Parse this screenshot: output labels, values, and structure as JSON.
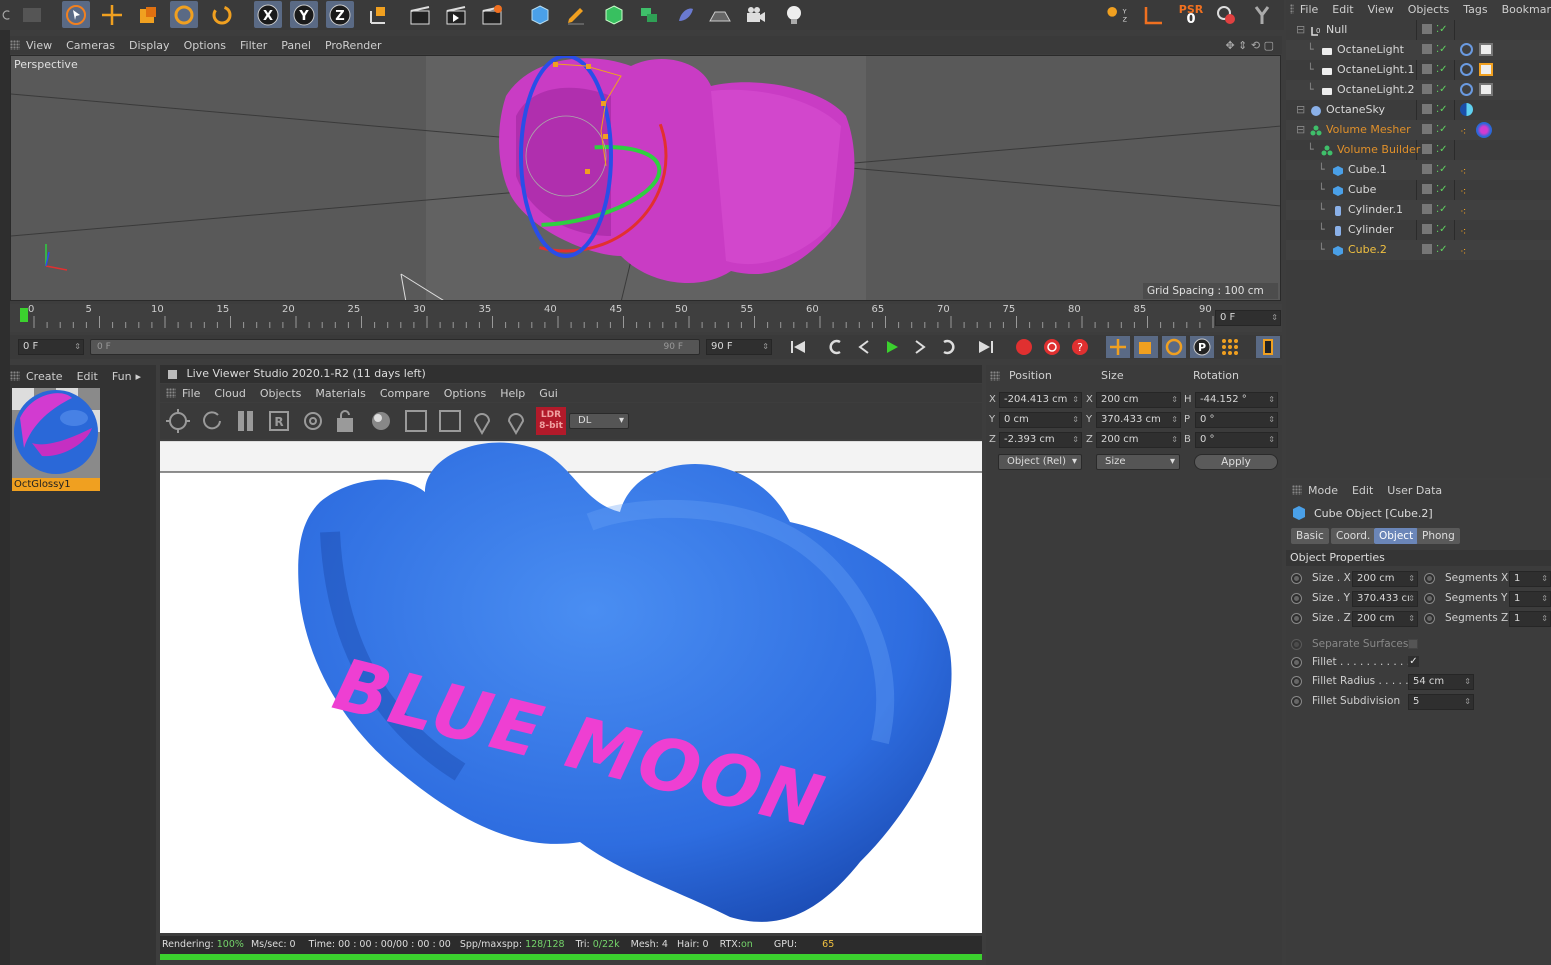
{
  "viewport": {
    "menu": [
      "View",
      "Cameras",
      "Display",
      "Options",
      "Filter",
      "Panel",
      "ProRender"
    ],
    "label": "Perspective",
    "grid_spacing": "Grid Spacing : 100 cm"
  },
  "timeline": {
    "ticks": [
      "0",
      "5",
      "10",
      "15",
      "20",
      "25",
      "30",
      "35",
      "40",
      "45",
      "50",
      "55",
      "60",
      "65",
      "70",
      "75",
      "80",
      "85",
      "90"
    ],
    "current_frame": "0 F",
    "start_field": "0 F",
    "range_start": "0 F",
    "range_end": "90 F",
    "end_field": "90 F"
  },
  "materials": {
    "menu": [
      "Create",
      "Edit",
      "Fun"
    ],
    "item_name": "OctGlossy1"
  },
  "live_viewer": {
    "title": "Live Viewer Studio 2020.1-R2 (11 days left)",
    "menu": [
      "File",
      "Cloud",
      "Objects",
      "Materials",
      "Compare",
      "Options",
      "Help",
      "Gui"
    ],
    "ldr_badge_1": "LDR",
    "ldr_badge_2": "8-bit",
    "mode_select": "DL",
    "render_text": "BLUE MOON",
    "status": {
      "rendering_label": "Rendering:",
      "rendering_value": "100%",
      "mssec": "Ms/sec: 0",
      "time": "Time: 00 : 00 : 00/00 : 00 : 00",
      "spp_label": "Spp/maxspp:",
      "spp_value": "128/128",
      "tri_label": "Tri:",
      "tri_value": "0/22k",
      "mesh": "Mesh: 4",
      "hair": "Hair: 0",
      "rtx_label": "RTX:",
      "rtx_value": "on",
      "gpu_label": "GPU:",
      "gpu_value": "65"
    }
  },
  "coordinates": {
    "headers": [
      "Position",
      "Size",
      "Rotation"
    ],
    "rows": [
      {
        "pos_axis": "X",
        "pos": "-204.413 cm",
        "size_axis": "X",
        "size": "200 cm",
        "rot_axis": "H",
        "rot": "-44.152 °"
      },
      {
        "pos_axis": "Y",
        "pos": "0 cm",
        "size_axis": "Y",
        "size": "370.433 cm",
        "rot_axis": "P",
        "rot": "0 °"
      },
      {
        "pos_axis": "Z",
        "pos": "-2.393 cm",
        "size_axis": "Z",
        "size": "200 cm",
        "rot_axis": "B",
        "rot": "0 °"
      }
    ],
    "mode_select": "Object (Rel)",
    "size_select": "Size",
    "apply_label": "Apply"
  },
  "object_manager": {
    "menu": [
      "File",
      "Edit",
      "View",
      "Objects",
      "Tags",
      "Bookmar"
    ],
    "objects": [
      {
        "name": "Null",
        "color": "#d8d8d8"
      },
      {
        "name": "OctaneLight",
        "color": "#d8d8d8"
      },
      {
        "name": "OctaneLight.1",
        "color": "#d8d8d8"
      },
      {
        "name": "OctaneLight.2",
        "color": "#d8d8d8"
      },
      {
        "name": "OctaneSky",
        "color": "#d8d8d8"
      },
      {
        "name": "Volume Mesher",
        "color": "#e0902a"
      },
      {
        "name": "Volume Builder",
        "color": "#e0902a"
      },
      {
        "name": "Cube.1",
        "color": "#d8d8d8"
      },
      {
        "name": "Cube",
        "color": "#d8d8d8"
      },
      {
        "name": "Cylinder.1",
        "color": "#d8d8d8"
      },
      {
        "name": "Cylinder",
        "color": "#d8d8d8"
      },
      {
        "name": "Cube.2",
        "color": "#f0c040"
      }
    ]
  },
  "attributes": {
    "menu": [
      "Mode",
      "Edit",
      "User Data"
    ],
    "object_title": "Cube Object [Cube.2]",
    "tabs": [
      "Basic",
      "Coord.",
      "Object",
      "Phong"
    ],
    "active_tab": "Object",
    "section": "Object Properties",
    "size_x_label": "Size . X",
    "size_x": "200 cm",
    "size_y_label": "Size . Y",
    "size_y": "370.433 cı",
    "size_z_label": "Size . Z",
    "size_z": "200 cm",
    "seg_x_label": "Segments X",
    "seg_x": "1",
    "seg_y_label": "Segments Y",
    "seg_y": "1",
    "seg_z_label": "Segments Z",
    "seg_z": "1",
    "separate_label": "Separate Surfaces",
    "fillet_label": "Fillet . . . . . . . . . . .",
    "fillet_checked": "✓",
    "fillet_radius_label": "Fillet Radius . . . . .",
    "fillet_radius": "54 cm",
    "fillet_subdiv_label": "Fillet Subdivision",
    "fillet_subdiv": "5"
  },
  "icons": {
    "psr_label": "PSR",
    "psr_value": "0",
    "x_axis": "X",
    "y_axis": "Y",
    "z_axis": "Z"
  },
  "colors": {
    "accent_blue": "#3a7be8",
    "magenta": "#d23bd0",
    "selection": "#6b86b8",
    "orange": "#e0902a",
    "green_bar": "#3bd12e"
  }
}
